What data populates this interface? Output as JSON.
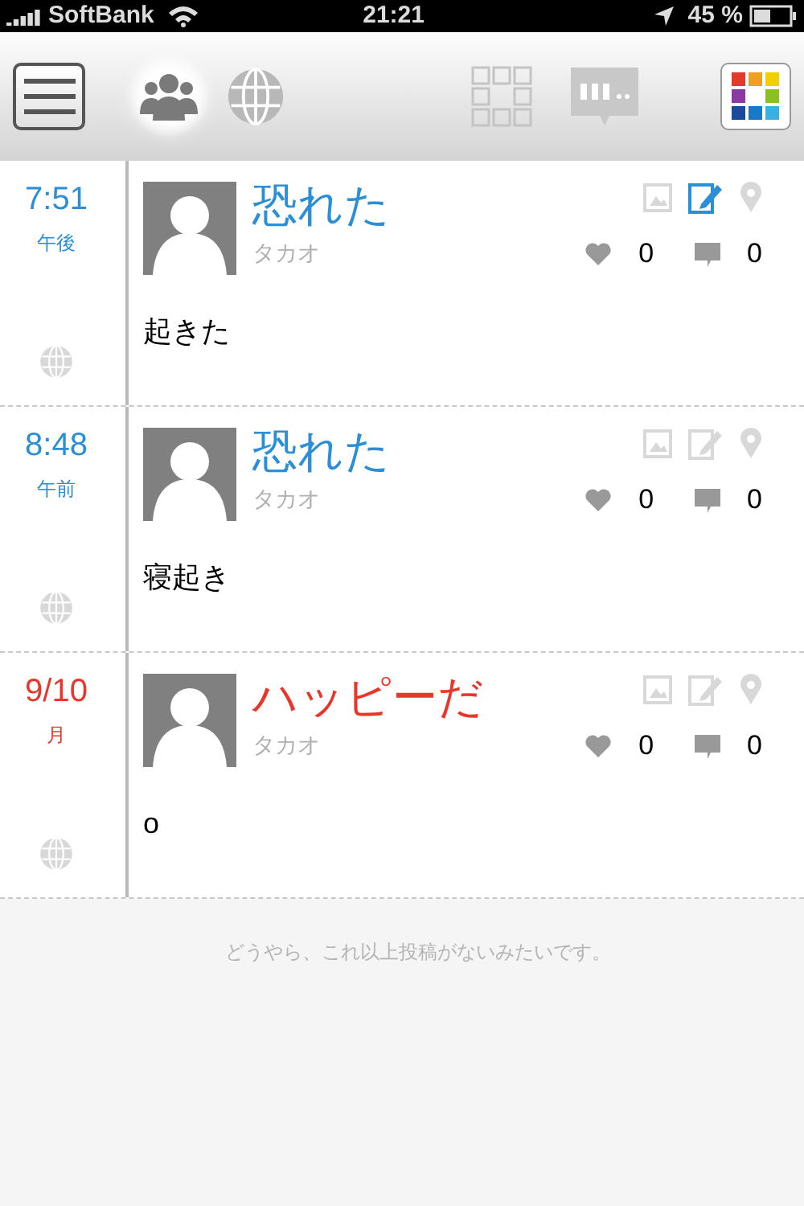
{
  "status_bar": {
    "carrier": "SoftBank",
    "time": "21:21",
    "battery": "45 %"
  },
  "toolbar": {
    "tabs": [
      {
        "kind": "people",
        "selected": true
      },
      {
        "kind": "globe",
        "selected": false
      }
    ]
  },
  "posts": [
    {
      "time": "7:51",
      "sub": "午後",
      "color": "#2a8fd6",
      "title": "恐れた",
      "author": "タカオ",
      "note": true,
      "likes": "0",
      "comments": "0",
      "body": "起きた"
    },
    {
      "time": "8:48",
      "sub": "午前",
      "color": "#2a8fd6",
      "title": "恐れた",
      "author": "タカオ",
      "note": false,
      "likes": "0",
      "comments": "0",
      "body": "寝起き"
    },
    {
      "time": "9/10",
      "sub": "月",
      "color": "#e8372a",
      "title": "ハッピーだ",
      "author": "タカオ",
      "note": false,
      "likes": "0",
      "comments": "0",
      "body": "o"
    }
  ],
  "footer": "どうやら、これ以上投稿がないみたいです。"
}
